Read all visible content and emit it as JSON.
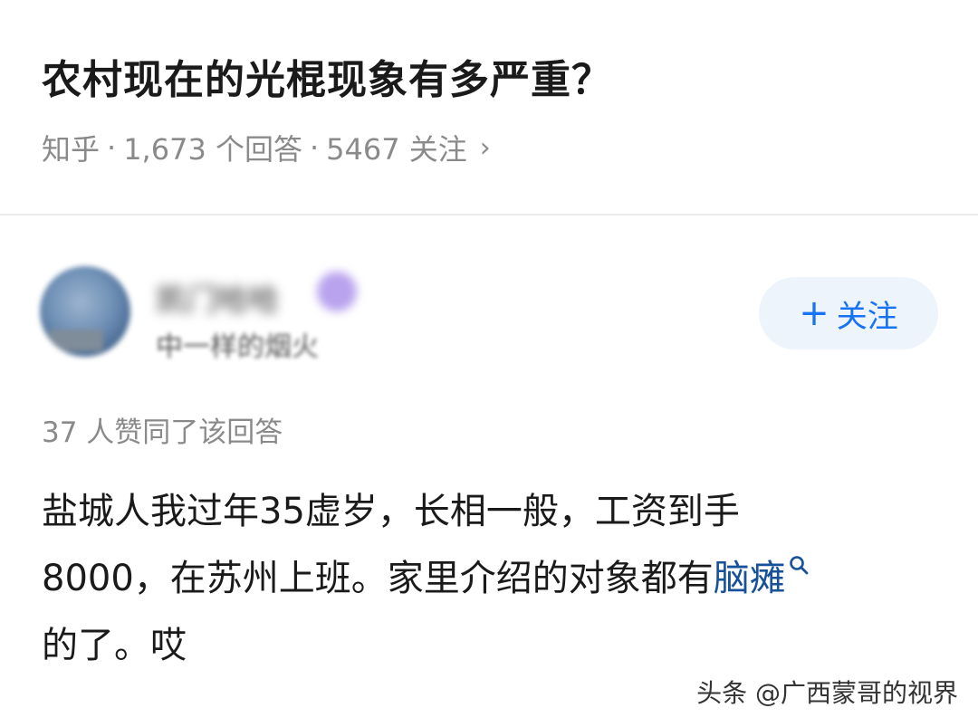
{
  "question": {
    "title": "农村现在的光棍现象有多严重？",
    "source": "知乎",
    "answers": "1,673 个回答",
    "followers": "5467 关注"
  },
  "author": {
    "name": "凯门哈哈",
    "description": "中一样的烟火",
    "follow_label": "关注",
    "follow_icon": "plus-icon"
  },
  "answer": {
    "upvote_text": "37 人赞同了该回答",
    "line1": "盐城人我过年35虚岁，长相一般，工资到手",
    "line2_prefix": "8000，在苏州上班。家里介绍的对象都有",
    "line2_keyword": "脑瘫",
    "line3": "的了。哎"
  },
  "watermark": "头条 @广西蒙哥的视界",
  "colors": {
    "accent": "#1772f6",
    "keyword": "#175199",
    "meta_gray": "#8a8a8a"
  }
}
